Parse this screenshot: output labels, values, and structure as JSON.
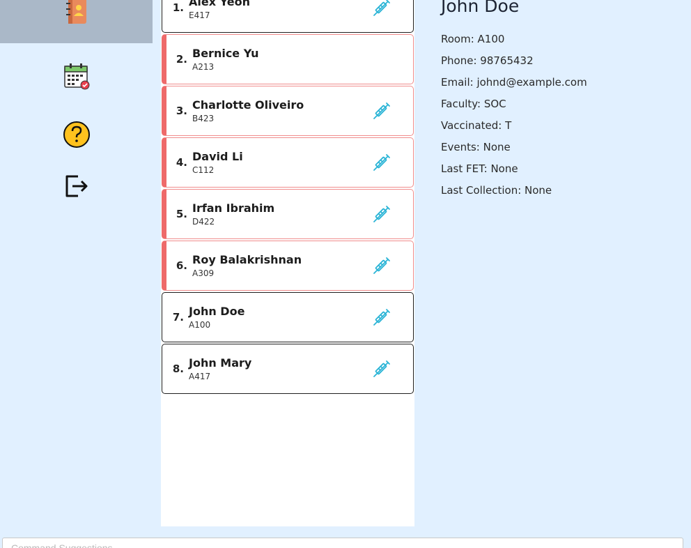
{
  "sidebar": {
    "items": [
      {
        "name": "contacts-book-icon",
        "active": true
      },
      {
        "name": "calendar-check-icon",
        "active": false
      },
      {
        "name": "help-icon",
        "active": false
      },
      {
        "name": "logout-icon",
        "active": false
      }
    ]
  },
  "residents": [
    {
      "index": "1.",
      "name": "Alex Yeon",
      "room": "E417",
      "flagged": false,
      "vaccinated": true
    },
    {
      "index": "2.",
      "name": "Bernice Yu",
      "room": "A213",
      "flagged": true,
      "vaccinated": false
    },
    {
      "index": "3.",
      "name": "Charlotte Oliveiro",
      "room": "B423",
      "flagged": true,
      "vaccinated": true
    },
    {
      "index": "4.",
      "name": "David Li",
      "room": "C112",
      "flagged": true,
      "vaccinated": true
    },
    {
      "index": "5.",
      "name": "Irfan Ibrahim",
      "room": "D422",
      "flagged": true,
      "vaccinated": true
    },
    {
      "index": "6.",
      "name": "Roy Balakrishnan",
      "room": "A309",
      "flagged": true,
      "vaccinated": true
    },
    {
      "index": "7.",
      "name": "John Doe",
      "room": "A100",
      "flagged": false,
      "vaccinated": true
    },
    {
      "index": "8.",
      "name": "John Mary",
      "room": "A417",
      "flagged": false,
      "vaccinated": true
    }
  ],
  "detail": {
    "name": "John Doe",
    "room": "Room: A100",
    "phone": "Phone: 98765432",
    "email": "Email: johnd@example.com",
    "faculty": "Faculty: SOC",
    "vaccinated": "Vaccinated: T",
    "events": "Events: None",
    "last_fet": "Last FET: None",
    "last_collection": "Last Collection: None"
  },
  "command": {
    "placeholder": "Command Suggestions"
  },
  "colors": {
    "background": "#e1f0ff",
    "active_nav": "#aab8c8",
    "flag_red": "#ee6a6a",
    "syringe_blue": "#2ab4d6"
  }
}
